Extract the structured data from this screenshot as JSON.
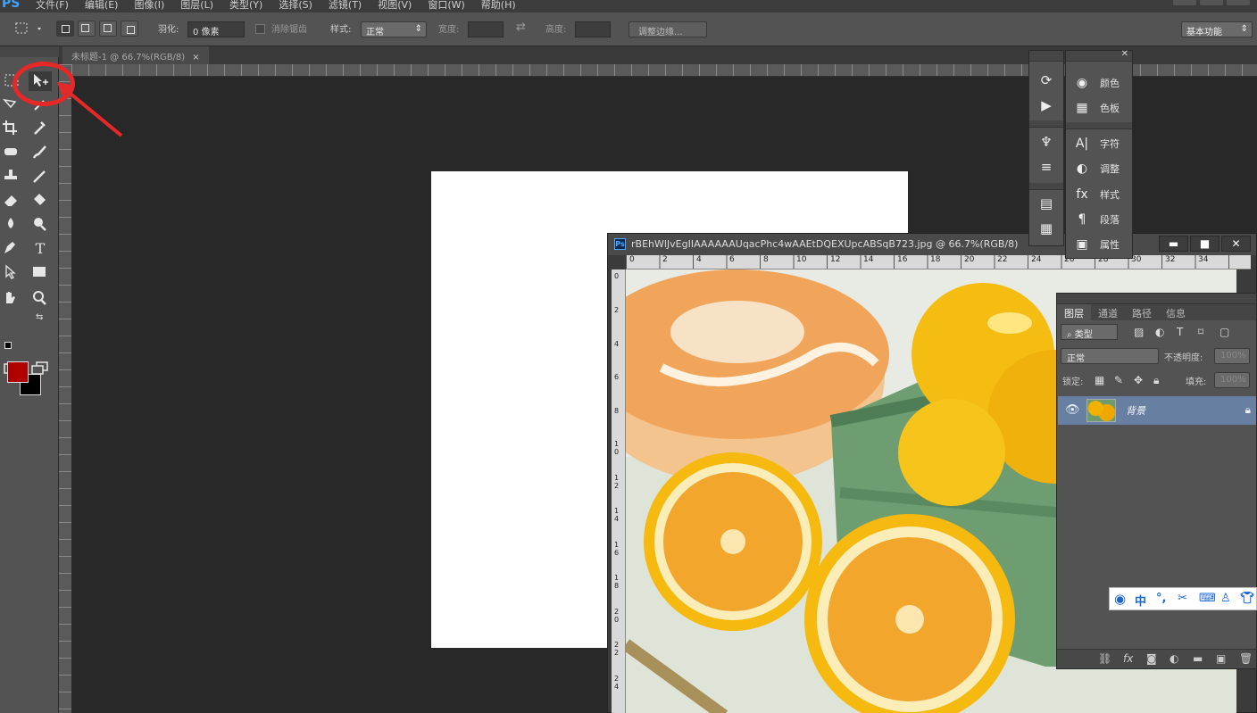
{
  "app": {
    "logo": "PS"
  },
  "menu": [
    "文件(F)",
    "编辑(E)",
    "图像(I)",
    "图层(L)",
    "类型(Y)",
    "选择(S)",
    "滤镜(T)",
    "视图(V)",
    "窗口(W)",
    "帮助(H)"
  ],
  "options": {
    "feather_label": "羽化:",
    "feather_value": "0 像素",
    "antialias_label": "消除锯齿",
    "style_label": "样式:",
    "style_value": "正常",
    "width_label": "宽度:",
    "height_label": "高度:",
    "refine_edge": "调整边缘...",
    "workspace": "基本功能"
  },
  "tab": {
    "title": "未标题-1 @ 66.7%(RGB/8)",
    "close": "×"
  },
  "image_window": {
    "title": "rBEhWlJvEgIIAAAAAAUqacPhc4wAAEtDQEXUpcABSqB723.jpg @ 66.7%(RGB/8)",
    "minimize": "▬",
    "maximize": "■",
    "close": "✕",
    "ruler_top": [
      "0",
      "2",
      "4",
      "6",
      "8",
      "10",
      "12",
      "14",
      "16",
      "18",
      "20",
      "22",
      "24",
      "26",
      "28",
      "30",
      "32",
      "34"
    ],
    "ruler_left": [
      "0",
      "2",
      "4",
      "6",
      "8",
      "1 0",
      "1 2",
      "1 4",
      "1 6",
      "1 8",
      "2 0",
      "2 2",
      "2 4"
    ]
  },
  "panels": {
    "color": "颜色",
    "swatches": "色板",
    "character": "字符",
    "adjustments": "调整",
    "styles": "样式",
    "paragraph": "段落",
    "properties": "属性"
  },
  "layers": {
    "tabs": [
      "图层",
      "通道",
      "路径",
      "信息"
    ],
    "filter_kind": "类型",
    "blend_mode": "正常",
    "opacity_label": "不透明度:",
    "opacity_value": "100%",
    "lock_label": "锁定:",
    "fill_label": "填充:",
    "fill_value": "100%",
    "items": [
      {
        "name": "背景"
      }
    ]
  },
  "ime": {
    "mode": "中"
  }
}
